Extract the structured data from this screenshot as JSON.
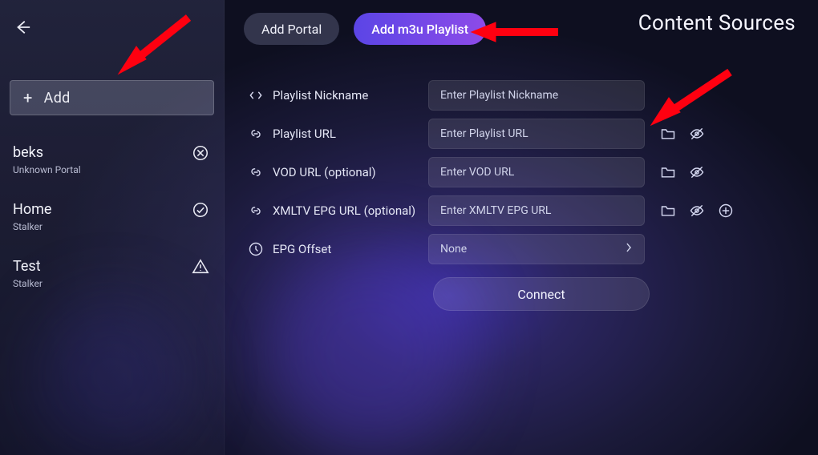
{
  "page_title": "Content Sources",
  "tabs": {
    "portal": "Add Portal",
    "m3u": "Add m3u Playlist"
  },
  "sidebar": {
    "add_label": "Add",
    "portals": [
      {
        "name": "beks",
        "sub": "Unknown Portal",
        "status": "error"
      },
      {
        "name": "Home",
        "sub": "Stalker",
        "status": "ok"
      },
      {
        "name": "Test",
        "sub": "Stalker",
        "status": "warn"
      }
    ]
  },
  "form": {
    "rows": {
      "nickname": {
        "label": "Playlist Nickname",
        "placeholder": "Enter Playlist Nickname"
      },
      "url": {
        "label": "Playlist URL",
        "placeholder": "Enter Playlist URL"
      },
      "vod": {
        "label": "VOD URL (optional)",
        "placeholder": "Enter VOD URL"
      },
      "epg": {
        "label": "XMLTV EPG URL (optional)",
        "placeholder": "Enter XMLTV EPG URL"
      },
      "offset": {
        "label": "EPG Offset",
        "value": "None"
      }
    },
    "connect_label": "Connect"
  }
}
